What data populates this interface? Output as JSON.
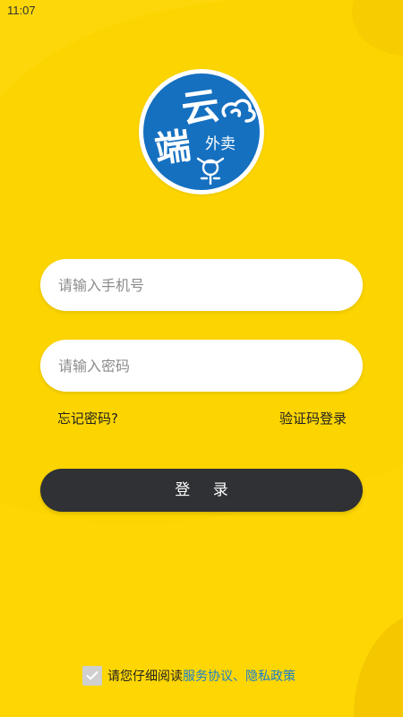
{
  "status_bar": {
    "time": "11:07"
  },
  "logo": {
    "characters": [
      "云",
      "端"
    ],
    "subtitle": "外卖",
    "icons": [
      "cloud-icon",
      "scooter-icon"
    ],
    "colors": {
      "circle": "#1570C0",
      "ring": "#FFFFFF",
      "text": "#FFFFFF"
    }
  },
  "login_form": {
    "phone_placeholder": "请输入手机号",
    "phone_value": "",
    "password_placeholder": "请输入密码",
    "password_value": "",
    "forgot_password": "忘记密码?",
    "sms_login": "验证码登录",
    "login_button": "登 录"
  },
  "agreement": {
    "checkbox_icon": "check-icon",
    "checked": true,
    "prefix": "请您仔细阅读",
    "terms": "服务协议",
    "separator": "、",
    "privacy": "隐私政策"
  },
  "colors": {
    "background": "#FCD500",
    "button": "#2F3134",
    "link_blue": "#1A7FCC"
  }
}
